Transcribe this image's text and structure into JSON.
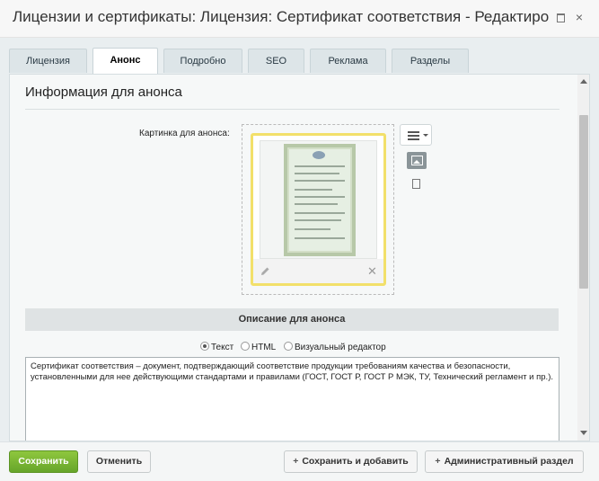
{
  "window": {
    "title": "Лицензии и сертификаты: Лицензия: Сертификат соответствия - Редактировани",
    "minimize_icon": "minimize-icon",
    "close_label": "×"
  },
  "tabs": [
    {
      "label": "Лицензия",
      "active": false
    },
    {
      "label": "Анонс",
      "active": true
    },
    {
      "label": "Подробно",
      "active": false
    },
    {
      "label": "SEO",
      "active": false
    },
    {
      "label": "Реклама",
      "active": false
    },
    {
      "label": "Разделы",
      "active": false
    }
  ],
  "section": {
    "title": "Информация для анонса",
    "image_label": "Картинка для анонса:",
    "image_edit_icon": "pencil-icon",
    "image_remove_label": "✕",
    "menu_icon": "menu-icon",
    "image_mode_icon": "image-icon",
    "file_mode_icon": "file-icon"
  },
  "description": {
    "header": "Описание для анонса",
    "modes": [
      {
        "label": "Текст",
        "selected": true
      },
      {
        "label": "HTML",
        "selected": false
      },
      {
        "label": "Визуальный редактор",
        "selected": false
      }
    ],
    "text": "Сертификат соответствия – документ, подтверждающий соответствие продукции требованиям качества и безопасности, установленными для нее действующими стандартами и правилами (ГОСТ, ГОСТ Р, ГОСТ Р МЭК, ТУ, Технический регламент и пр.)."
  },
  "footer": {
    "save": "Сохранить",
    "cancel": "Отменить",
    "save_add": "Сохранить и добавить",
    "admin": "Административный раздел",
    "plus": "+"
  },
  "colors": {
    "save_button": "#77b434",
    "image_border": "#f2e06a"
  }
}
